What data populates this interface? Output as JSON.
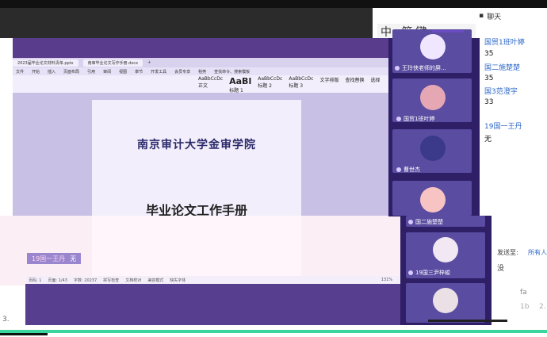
{
  "ime": {
    "mode": "中",
    "punct": "·",
    "layout": "简",
    "extra": "键"
  },
  "app": {
    "tabs": [
      "2023届毕业论文材料清单.pptx",
      "南审毕业论文写作手册.docx"
    ],
    "menu": [
      "文件",
      "开始",
      "插入",
      "页面布局",
      "引用",
      "审阅",
      "视图",
      "章节",
      "开发工具",
      "会员专享",
      "稻壳",
      "查找命令、搜索模板"
    ],
    "styles": [
      "AaBbCcDc",
      "AaBl",
      "AaBbCcDc",
      "AaBbCcDc"
    ],
    "style_names": [
      "正文",
      "标题 1",
      "标题 2",
      "标题 3"
    ],
    "right_tools": [
      "文字排版",
      "查找替换",
      "选择"
    ],
    "status": [
      "页码: 1",
      "页面: 1/43",
      "字数: 20237",
      "拼写检查",
      "文档校对",
      "兼容模式",
      "缺失字体"
    ],
    "zoom": "131%"
  },
  "document": {
    "school": "南京审计大学金审学院",
    "title": "毕业论文工作手册"
  },
  "toast": {
    "name": "19国一王丹",
    "text": "无"
  },
  "chat": {
    "header": "聊天",
    "messages": [
      {
        "name": "国贸1班叶婷",
        "text": "35"
      },
      {
        "name": "国二施楚楚",
        "text": "35"
      },
      {
        "name": "国3范澄宇",
        "text": "33"
      },
      {
        "name": "19国一王丹",
        "text": "无"
      }
    ],
    "send_to_label": "发送至:",
    "send_to_value": "所有人",
    "fragment": "没",
    "fragment2": "fa",
    "fragment3": "1b",
    "fragment4": "2."
  },
  "gallery": {
    "participants": [
      {
        "name": "王玲侠老师的屏..."
      },
      {
        "name": "国贸1班叶婷"
      },
      {
        "name": "曹世杰"
      },
      {
        "name": "国二施楚楚"
      },
      {
        "name": "19国三尹梓峻"
      }
    ]
  },
  "bottom": {
    "left": "3."
  },
  "colors": {
    "share_bg": "#5a3c8c",
    "gallery_bg": "#2e1f66",
    "chat_name": "#2f68c9"
  }
}
